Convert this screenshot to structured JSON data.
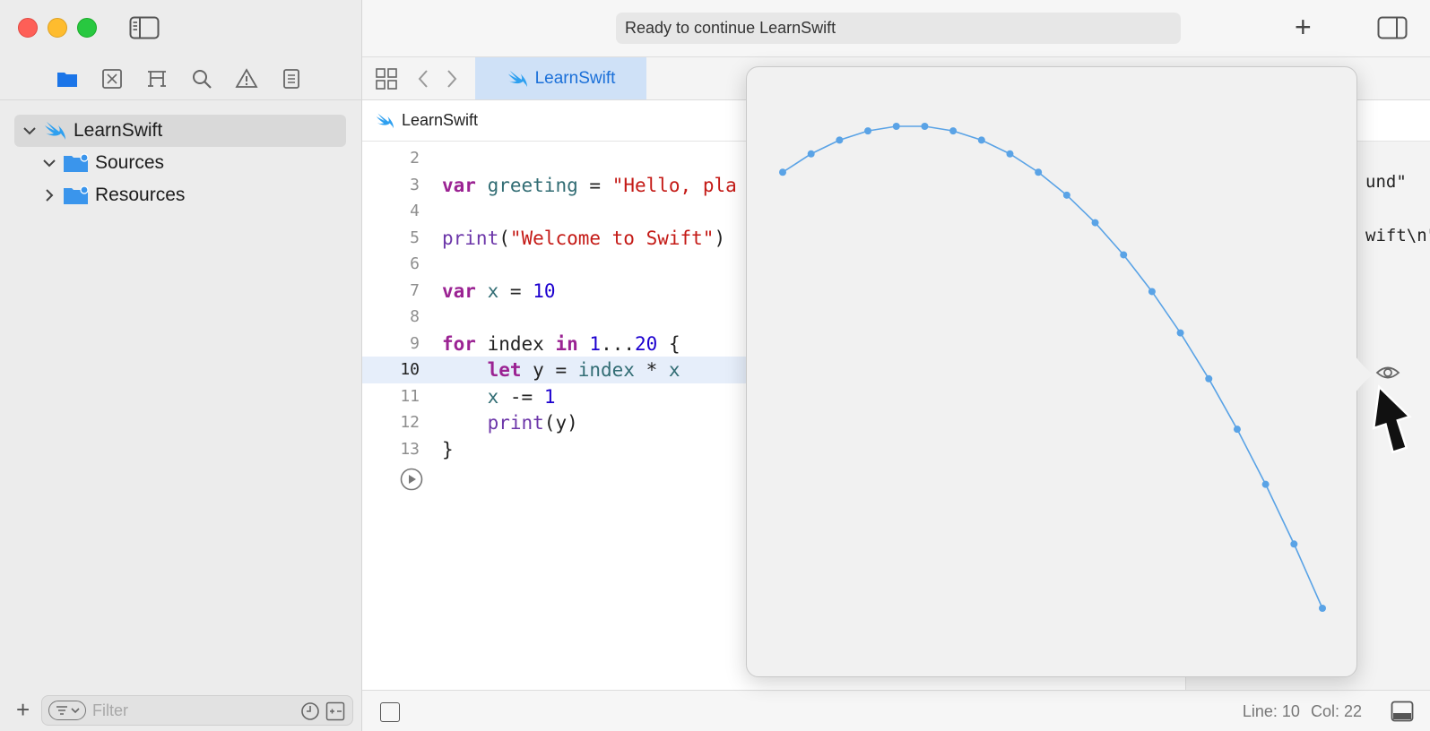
{
  "window": {
    "status_text": "Ready to continue LearnSwift"
  },
  "navigator": {
    "project": "LearnSwift",
    "items": [
      {
        "label": "Sources",
        "expanded": true
      },
      {
        "label": "Resources",
        "expanded": false
      }
    ],
    "filter_placeholder": "Filter"
  },
  "tabs": {
    "active_label": "LearnSwift"
  },
  "breadcrumb": {
    "label": "LearnSwift"
  },
  "editor": {
    "lines": [
      {
        "n": "2",
        "html": ""
      },
      {
        "n": "3",
        "html": "<span class=\"kw\">var</span> <span class=\"ident\">greeting</span> = <span class=\"str\">\"Hello, pla</span>"
      },
      {
        "n": "4",
        "html": ""
      },
      {
        "n": "5",
        "html": "<span class=\"fn\">print</span>(<span class=\"str\">\"Welcome to Swift\"</span>)"
      },
      {
        "n": "6",
        "html": ""
      },
      {
        "n": "7",
        "html": "<span class=\"kw\">var</span> <span class=\"ident\">x</span> = <span class=\"num\">10</span>"
      },
      {
        "n": "8",
        "html": ""
      },
      {
        "n": "9",
        "html": "<span class=\"kw\">for</span> index <span class=\"kw\">in</span> <span class=\"num\">1</span>...<span class=\"num\">20</span> {"
      },
      {
        "n": "10",
        "html": "    <span class=\"kw\">let</span> y = <span class=\"ident\">index</span> * <span class=\"ident\">x</span>",
        "current": true
      },
      {
        "n": "11",
        "html": "    <span class=\"ident\">x</span> -= <span class=\"num\">1</span>"
      },
      {
        "n": "12",
        "html": "    <span class=\"fn\">print</span>(y)"
      },
      {
        "n": "13",
        "html": "}"
      }
    ],
    "results": {
      "line3": "und\"",
      "line5": "wift\\n\""
    }
  },
  "status": {
    "line": "Line: 10",
    "col": "Col: 22"
  },
  "colors": {
    "accent": "#1a6fd8",
    "plot": "#5aa3e6"
  },
  "chart_data": {
    "type": "line",
    "x": [
      1,
      2,
      3,
      4,
      5,
      6,
      7,
      8,
      9,
      10,
      11,
      12,
      13,
      14,
      15,
      16,
      17,
      18,
      19,
      20
    ],
    "values": [
      10,
      18,
      24,
      28,
      30,
      30,
      28,
      24,
      18,
      10,
      0,
      -12,
      -26,
      -42,
      -60,
      -80,
      -102,
      -126,
      -152,
      -180
    ],
    "ylim": [
      -180,
      30
    ],
    "grid": false
  }
}
